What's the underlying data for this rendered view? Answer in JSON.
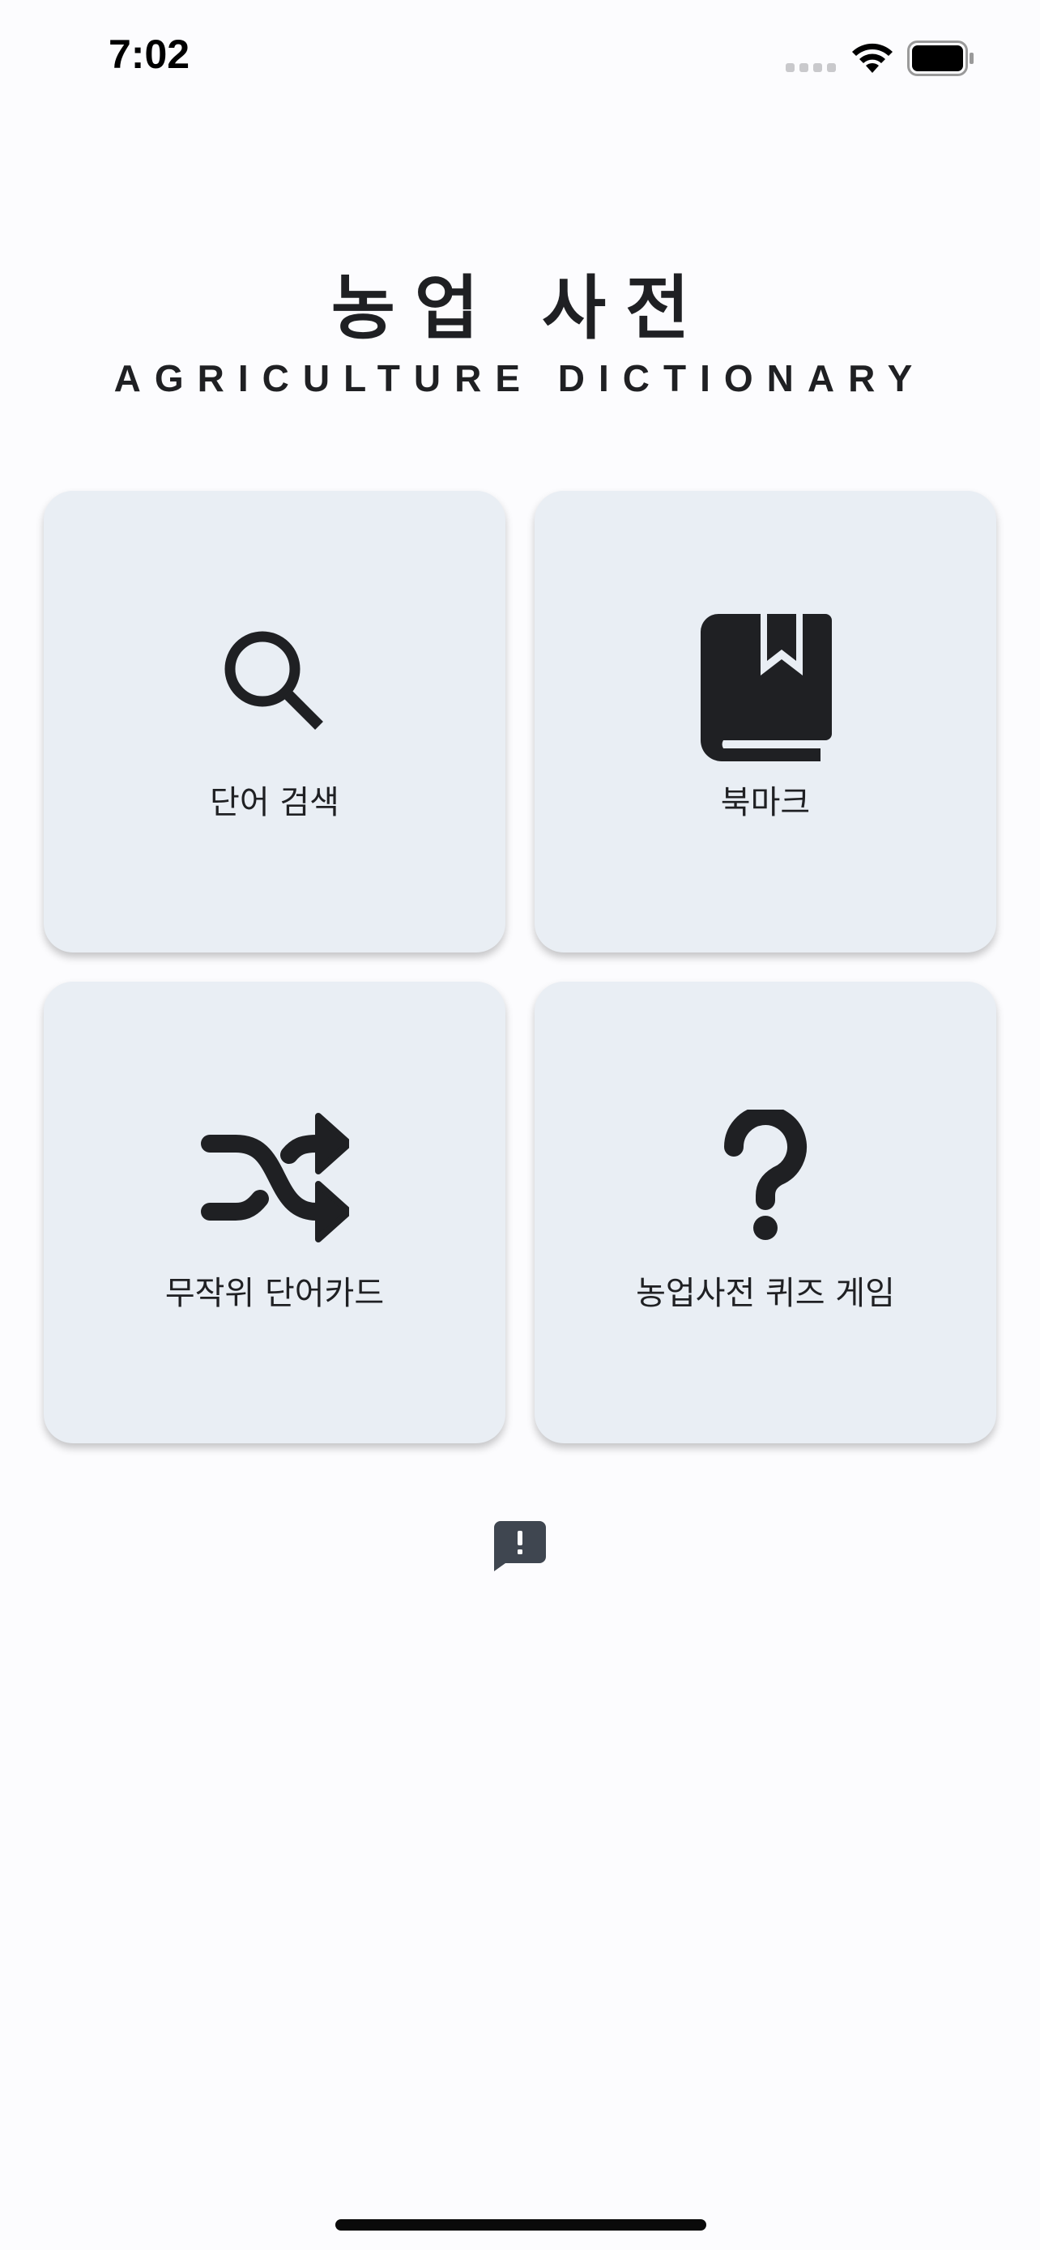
{
  "status_bar": {
    "time": "7:02",
    "wifi_icon": "wifi-icon",
    "battery_icon": "battery-full-icon"
  },
  "header": {
    "title_ko": "농업 사전",
    "title_en": "AGRICULTURE DICTIONARY"
  },
  "menu": [
    {
      "label": "단어 검색",
      "icon": "search-icon"
    },
    {
      "label": "북마크",
      "icon": "bookmark-book-icon"
    },
    {
      "label": "무작위 단어카드",
      "icon": "shuffle-icon"
    },
    {
      "label": "농업사전 퀴즈 게임",
      "icon": "question-mark-icon"
    }
  ],
  "footer": {
    "feedback_icon": "feedback-report-icon"
  },
  "colors": {
    "background": "#fcfcfe",
    "card_background": "#e9eef4",
    "text": "#1f2023",
    "feedback_icon": "#3f4650"
  }
}
